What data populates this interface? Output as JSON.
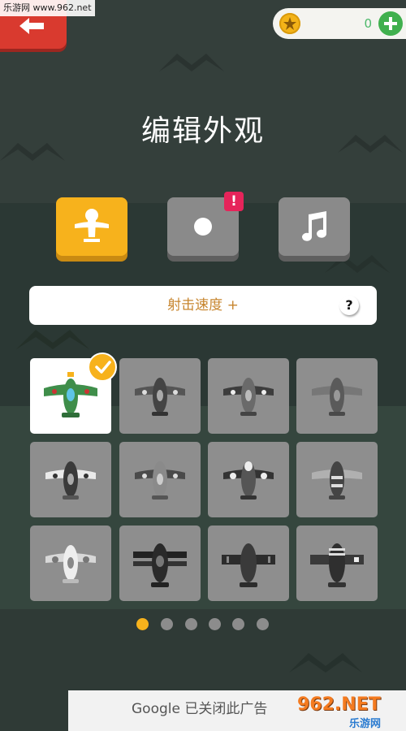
{
  "watermark": "乐游网 www.962.net",
  "header": {
    "back_icon": "arrow-left-icon",
    "coin_icon": "coin-icon",
    "coin_count": "0",
    "add_icon": "plus-icon"
  },
  "page_title": "编辑外观",
  "tabs": [
    {
      "name": "plane",
      "icon": "plane-icon",
      "active": true
    },
    {
      "name": "bullet",
      "icon": "dot-icon",
      "active": false,
      "badge": "!"
    },
    {
      "name": "music",
      "icon": "music-note-icon",
      "active": false
    }
  ],
  "info_bar": {
    "text": "射击速度 +",
    "help": "?"
  },
  "skins": [
    {
      "selected": true,
      "color": "#3f8e4a"
    },
    {
      "selected": false
    },
    {
      "selected": false
    },
    {
      "selected": false
    },
    {
      "selected": false
    },
    {
      "selected": false
    },
    {
      "selected": false
    },
    {
      "selected": false
    },
    {
      "selected": false
    },
    {
      "selected": false
    },
    {
      "selected": false
    },
    {
      "selected": false
    }
  ],
  "pagination": {
    "total": 6,
    "current": 1
  },
  "ad": {
    "text": "Google 已关闭此广告",
    "logo_main": "962.NET",
    "logo_sub": "乐游网"
  },
  "colors": {
    "accent": "#f7b21c",
    "back": "#d93a2f",
    "add": "#40b04e",
    "badge": "#e6245a",
    "info_text": "#c7852e"
  }
}
